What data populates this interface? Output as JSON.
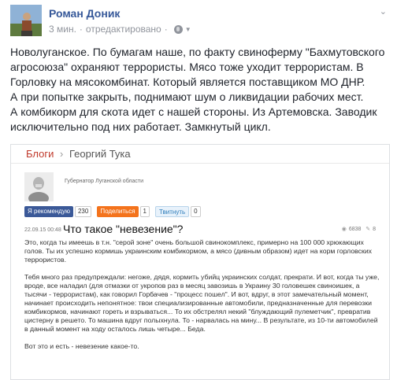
{
  "post": {
    "author": "Роман Доник",
    "time": "3 мин.",
    "separator": "·",
    "edited": "отредактировано",
    "text_lines": [
      "Новолуганское. По бумагам наше, по факту свиноферму \"Бахмутовского",
      "агросоюза\" охраняют террористы. Мясо тоже уходит террористам. В",
      "Горловку на мясокомбинат. Который является поставщиком МО ДНР.",
      "А при попытке закрыть, поднимают шум о ликвидации рабочих мест.",
      "А комбикорм для скота идет с нашей стороны. Из Артемовска. Заводик",
      "исключительно под них работает. Замкнутый цикл."
    ]
  },
  "shared": {
    "breadcrumb_section": "Блоги",
    "breadcrumb_arrow": "›",
    "breadcrumb_author": "Георгий Тука",
    "author_role": "Губернатор Луганской области",
    "social": {
      "fb_label": "Я рекомендую",
      "fb_count": "230",
      "ok_label": "Поделиться",
      "ok_count": "1",
      "tw_label": "Твитнуть",
      "tw_count": "0"
    },
    "date": "22.09.15 00:48",
    "title": "Что такое \"невезение\"?",
    "views": "6838",
    "comments": "8",
    "paragraphs": [
      "Это, когда ты имеешь в т.н. \"серой зоне\" очень большой свинокомплекс, примерно на 100 000 хрюкающих голов. Ты их успешно кормишь украинским комбикормом, а мясо (дивным образом) идет на корм горловских террористов.",
      "Тебя много раз предупреждали: негоже, дядя, кормить убийц украинских солдат, прекрати. И вот, когда ты уже, вроде, все наладил (для отмазки от укропов раз в месяц завозишь в Украину 30 головешек свиноишек, а тысячи - террористам), как говорил Горбачев - \"процесс пошел\". И вот, вдруг, в этот замечательный момент, начинает происходить непонятное: твои специализированные автомобили, предназначенные для перевозки комбикормов, начинают гореть и взрываться... То их обстрелял некий \"блуждающий пулеметчик\", превратив цистерну в решето. То машина вдруг полыхнула. То - нарвалась на мину... В результате, из 10-ти автомобилей в данный момент на ходу осталось лишь четыре... Беда.",
      "Вот это и есть - невезение какое-то."
    ]
  },
  "colors": {
    "link_blue": "#365899",
    "meta_gray": "#90949c",
    "breadcrumb_red": "#c0392b",
    "facebook": "#3b5998",
    "odnoklassniki": "#f4731c"
  }
}
